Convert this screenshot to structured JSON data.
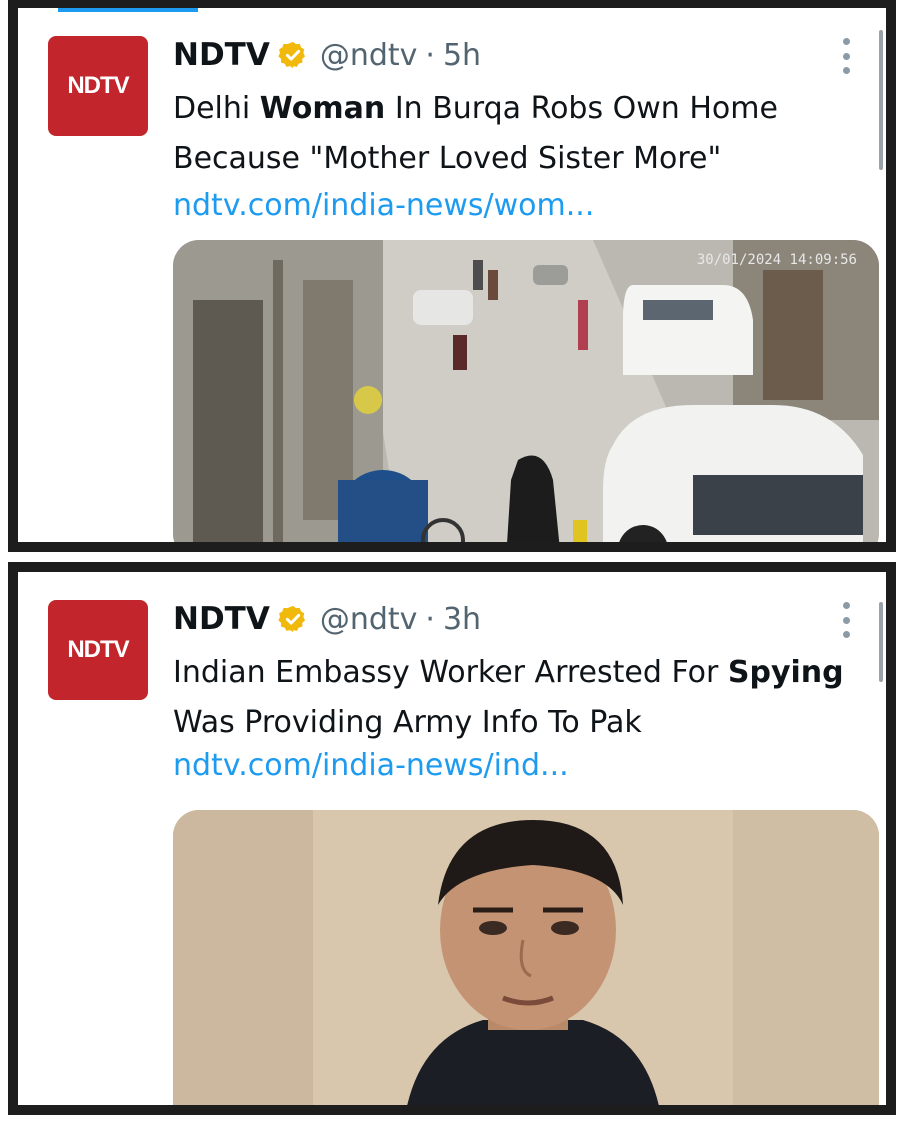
{
  "colors": {
    "frame": "#1d1d1d",
    "brand_red": "#c2262c",
    "link_blue": "#1d9bf0",
    "meta_gray": "#536471",
    "verified_gold": "#f0b90b"
  },
  "tweets": [
    {
      "author": "NDTV",
      "avatar_text": "NDTV",
      "verified_icon": "verified-gold-badge",
      "handle": "@ndtv",
      "separator": "·",
      "time": "5h",
      "text_parts": [
        "Delhi ",
        "Woman",
        " In Burqa Robs Own Home Because \"Mother Loved Sister More\""
      ],
      "link": "ndtv.com/india-news/wom...",
      "media_timestamp": "30/01/2024 14:09:56"
    },
    {
      "author": "NDTV",
      "avatar_text": "NDTV",
      "verified_icon": "verified-gold-badge",
      "handle": "@ndtv",
      "separator": "·",
      "time": "3h",
      "text_parts": [
        "Indian Embassy Worker Arrested For ",
        "Spying",
        " Was Providing Army Info To Pak"
      ],
      "link": "ndtv.com/india-news/ind..."
    }
  ]
}
